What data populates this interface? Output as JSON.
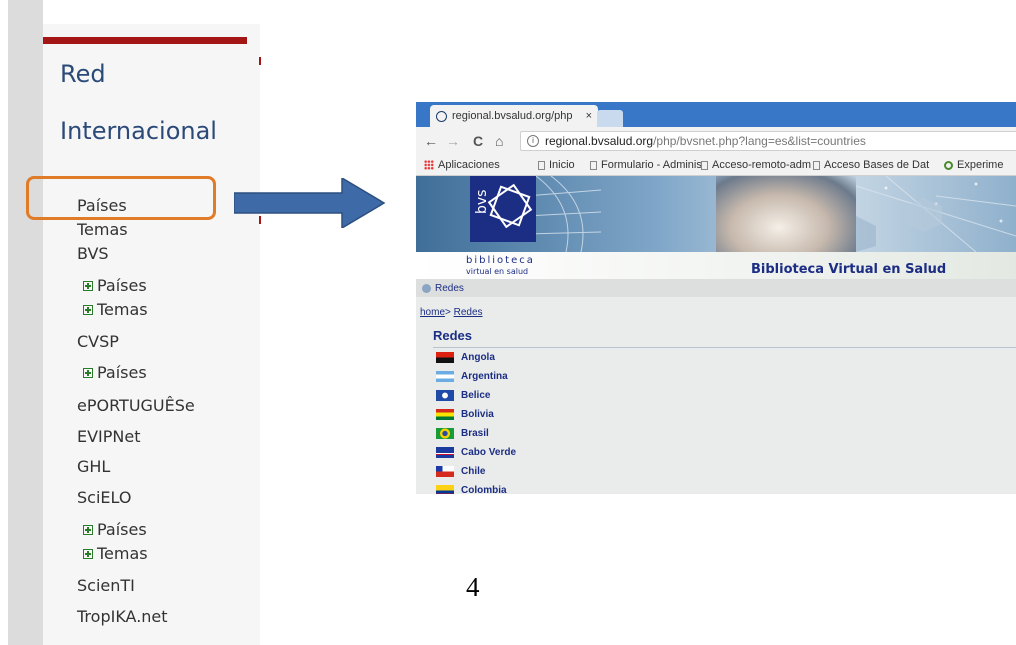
{
  "sidebar": {
    "title_line1": "Red",
    "title_line2": "Internacional",
    "items": [
      {
        "label": "Países"
      },
      {
        "label": "Temas"
      },
      {
        "label": "BVS"
      },
      {
        "label": "Países"
      },
      {
        "label": "Temas"
      },
      {
        "label": "CVSP"
      },
      {
        "label": "Países"
      },
      {
        "label": "ePORTUGUÊSe"
      },
      {
        "label": "EVIPNet"
      },
      {
        "label": "GHL"
      },
      {
        "label": "SciELO"
      },
      {
        "label": "Países"
      },
      {
        "label": "Temas"
      },
      {
        "label": "ScienTI"
      },
      {
        "label": "TropIKA.net"
      }
    ]
  },
  "browser": {
    "tab_title": "regional.bvsalud.org/php",
    "tab_close": "×",
    "nav": {
      "back": "←",
      "forward": "→",
      "reload": "C",
      "home": "⌂"
    },
    "url_domain": "regional.bvsalud.org",
    "url_path": "/php/bvsnet.php?lang=es&list=countries",
    "url_info": "i",
    "bookmarks": [
      "Aplicaciones",
      "Inicio",
      "Formulario - Adminis",
      "Acceso-remoto-adm",
      "Acceso Bases de Dat",
      "Experime"
    ]
  },
  "site": {
    "logo_text": "bvs",
    "logo_biblio": "biblioteca",
    "logo_virtual": "virtual en salud",
    "banner_title": "Biblioteca Virtual en Salud",
    "strip_label": "Redes",
    "crumb_home": "home",
    "crumb_sep": ">",
    "crumb_redes": "Redes",
    "section_title": "Redes",
    "countries": [
      "Angola",
      "Argentina",
      "Belice",
      "Bolivia",
      "Brasil",
      "Cabo Verde",
      "Chile",
      "Colombia"
    ]
  },
  "page_number": "4",
  "colors": {
    "accent_highlight": "#e07b28",
    "arrow_fill": "#3e6aa8",
    "brand_blue": "#1c2d84",
    "sidebar_red": "#a41616"
  }
}
